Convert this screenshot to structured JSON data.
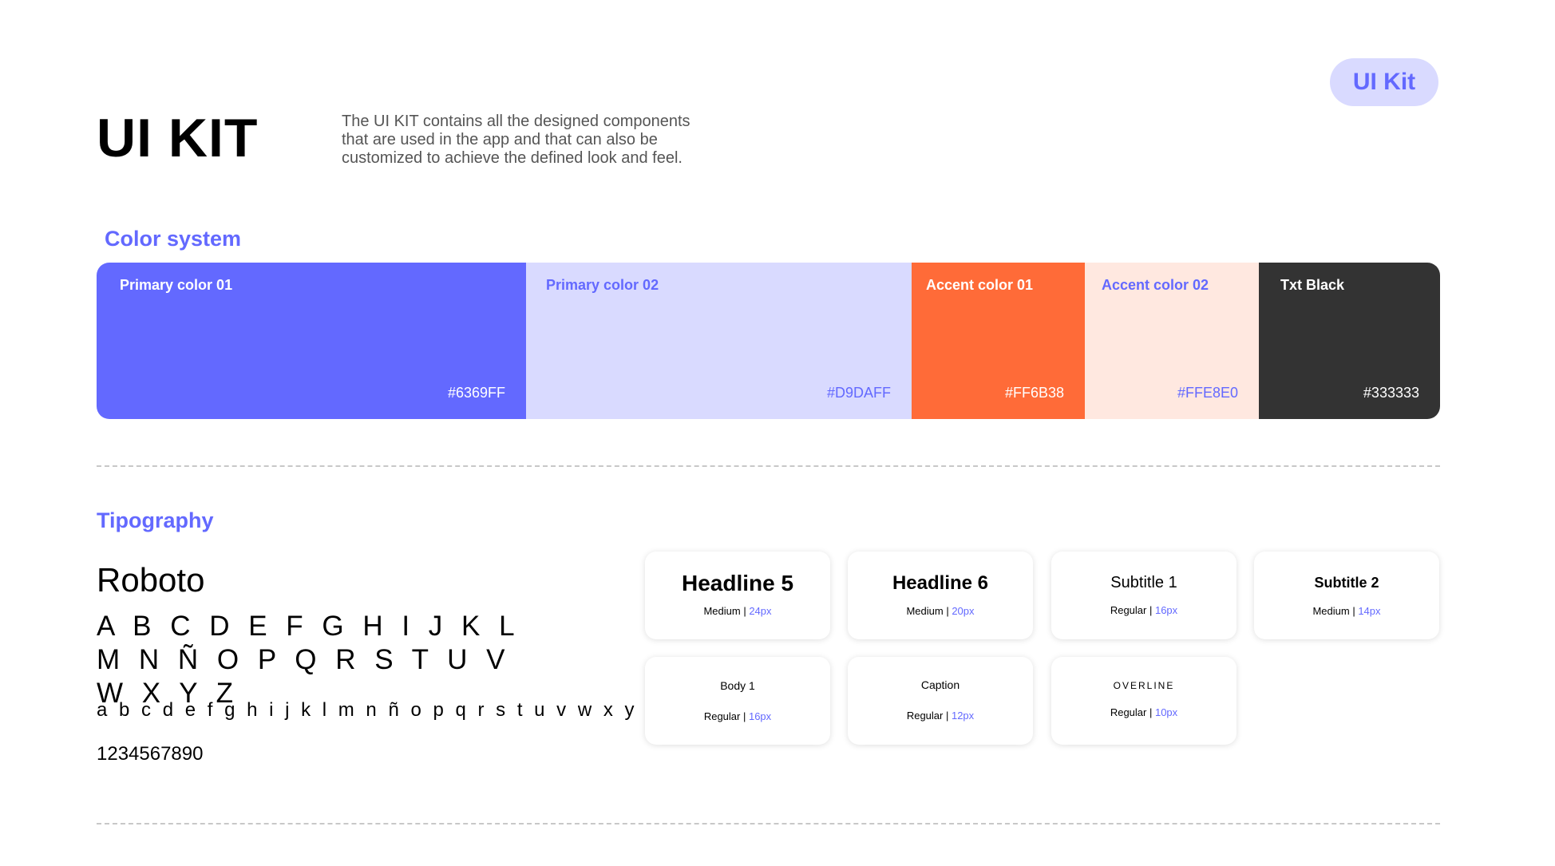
{
  "header": {
    "title": "UI KIT",
    "description": "The UI KIT contains all the designed components that are used in the app and that can also be customized to achieve the defined look and feel.",
    "badge": "UI Kit"
  },
  "color_system": {
    "title": "Color system",
    "swatches": [
      {
        "name": "Primary color 01",
        "hex": "#6369FF",
        "bg": "#6369ff",
        "text_color": "#ffffff"
      },
      {
        "name": "Primary color 02",
        "hex": "#D9DAFF",
        "bg": "#d9daff",
        "text_color": "#6369ff"
      },
      {
        "name": "Accent color 01",
        "hex": "#FF6B38",
        "bg": "#ff6b38",
        "text_color": "#ffffff"
      },
      {
        "name": "Accent color 02",
        "hex": "#FFE8E0",
        "bg": "#ffe8e0",
        "text_color": "#6369ff"
      },
      {
        "name": "Txt Black",
        "hex": "#333333",
        "bg": "#333333",
        "text_color": "#ffffff"
      }
    ]
  },
  "typography": {
    "title": "Tipography",
    "font_name": "Roboto",
    "uppercase": "A B C D E F G H I J K L M N Ñ O P Q R S T U V W X Y Z",
    "lowercase": "a b c d e f g h i j k l m n ñ o p q r s t u v w x y z",
    "digits": "1234567890",
    "styles": [
      {
        "sample": "Headline 5",
        "weight": "Medium",
        "size": "24px"
      },
      {
        "sample": "Headline 6",
        "weight": "Medium",
        "size": "20px"
      },
      {
        "sample": "Subtitle 1",
        "weight": "Regular",
        "size": "16px"
      },
      {
        "sample": "Subtitle 2",
        "weight": "Medium",
        "size": "14px"
      },
      {
        "sample": "Body 1",
        "weight": "Regular",
        "size": "16px"
      },
      {
        "sample": "Caption",
        "weight": "Regular",
        "size": "12px"
      },
      {
        "sample": "OVERLINE",
        "weight": "Regular",
        "size": "10px"
      }
    ],
    "separator": " | "
  }
}
